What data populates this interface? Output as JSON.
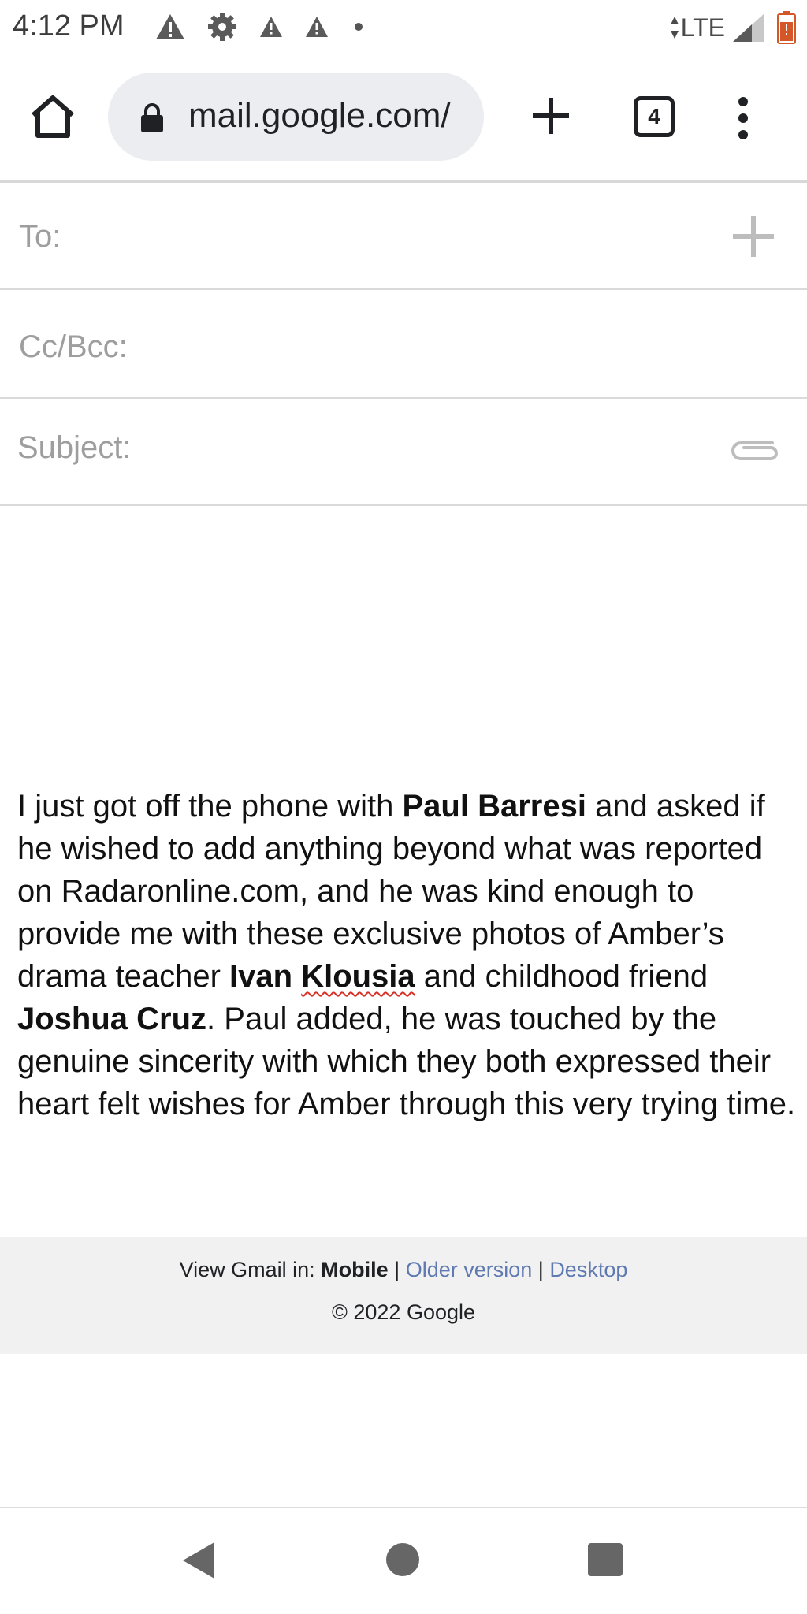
{
  "status_bar": {
    "time": "4:12 PM",
    "network": "LTE",
    "icons": [
      "warning-icon",
      "gear-icon",
      "warning-icon",
      "warning-icon",
      "dot-icon",
      "signal-icon",
      "battery-icon"
    ]
  },
  "browser": {
    "url": "mail.google.com/",
    "tab_count": "4",
    "icons": [
      "home-icon",
      "lock-icon",
      "plus-icon",
      "tabs-icon",
      "more-vert-icon"
    ]
  },
  "compose": {
    "to_label": "To:",
    "cc_label": "Cc/Bcc:",
    "subject_label": "Subject:",
    "body": {
      "p1": "I just got off the phone with ",
      "name1": "Paul Barresi",
      "p2": " and asked if he wished to add anything beyond what was reported on Radaronline.com, and he was kind enough to provide me with these exclusive photos of Amber’s drama teacher ",
      "name2a": "Ivan ",
      "name2b": "Klousia",
      "p3": " and childhood friend ",
      "name3": "Joshua Cruz",
      "p4": ".   Paul added, he was touched by the genuine sincerity with which they both expressed their heart felt wishes for Amber through this very trying time."
    }
  },
  "footer": {
    "view_in": "View Gmail in: ",
    "mobile": "Mobile",
    "sep": " | ",
    "older": "Older version",
    "desktop": "Desktop",
    "copyright": "© 2022 Google"
  },
  "colors": {
    "link": "#5f7ab2",
    "label_gray": "#9e9e9e",
    "footer_bg": "#f1f1f1",
    "spell_underline": "#d93025"
  }
}
